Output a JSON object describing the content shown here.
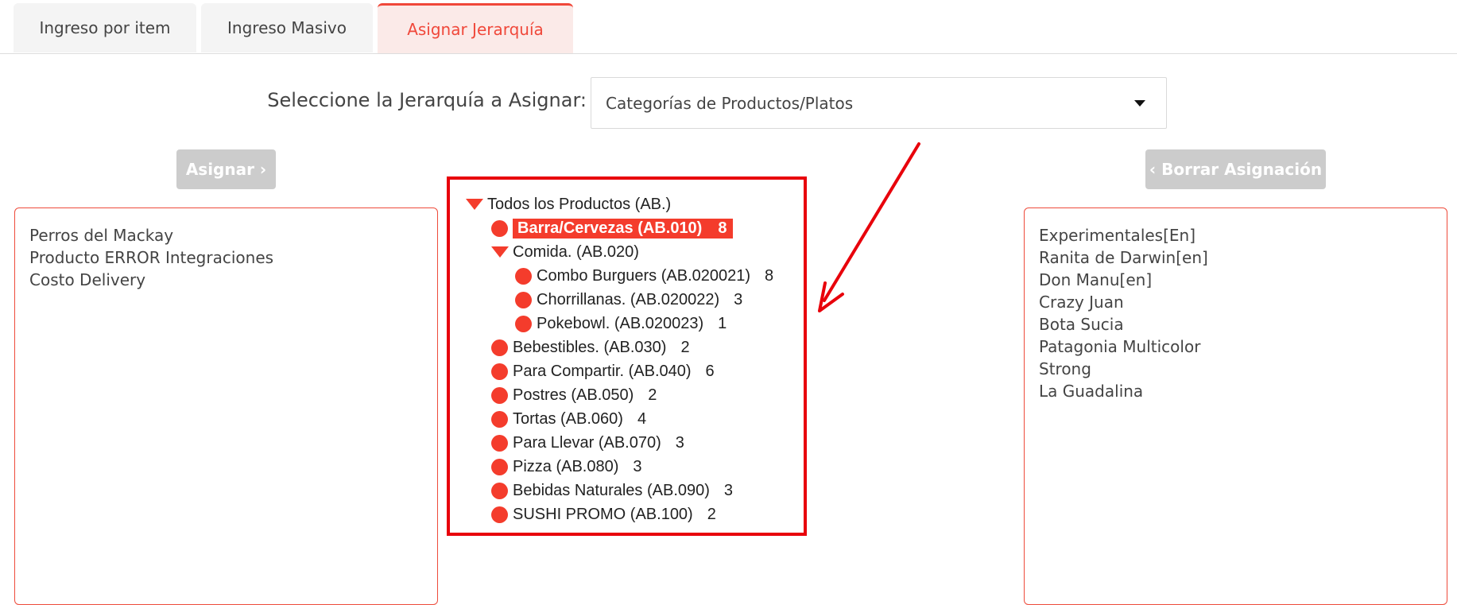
{
  "tabs": [
    {
      "label": "Ingreso por item",
      "active": false
    },
    {
      "label": "Ingreso Masivo",
      "active": false
    },
    {
      "label": "Asignar Jerarquía",
      "active": true
    }
  ],
  "selector": {
    "label": "Seleccione la Jerarquía a Asignar:",
    "value": "Categorías de Productos/Platos"
  },
  "buttons": {
    "assign": "Asignar ›",
    "clear": "‹ Borrar Asignación"
  },
  "left_list": [
    "Perros del Mackay",
    "Producto ERROR Integraciones",
    "Costo Delivery"
  ],
  "tree": {
    "root": "Todos los Productos (AB.)",
    "selected": {
      "label": "Barra/Cervezas (AB.010)",
      "count": "8"
    },
    "comida": "Comida. (AB.020)",
    "comida_children": [
      {
        "label": "Combo Burguers (AB.020021)",
        "count": "8"
      },
      {
        "label": "Chorrillanas. (AB.020022)",
        "count": "3"
      },
      {
        "label": "Pokebowl. (AB.020023)",
        "count": "1"
      }
    ],
    "items": [
      {
        "label": "Bebestibles. (AB.030)",
        "count": "2"
      },
      {
        "label": "Para Compartir. (AB.040)",
        "count": "6"
      },
      {
        "label": "Postres (AB.050)",
        "count": "2"
      },
      {
        "label": "Tortas (AB.060)",
        "count": "4"
      },
      {
        "label": "Para Llevar (AB.070)",
        "count": "3"
      },
      {
        "label": "Pizza (AB.080)",
        "count": "3"
      },
      {
        "label": "Bebidas Naturales (AB.090)",
        "count": "3"
      },
      {
        "label": "SUSHI PROMO (AB.100)",
        "count": "2"
      }
    ]
  },
  "right_list": [
    "Experimentales[En]",
    "Ranita de Darwin[en]",
    "Don Manu[en]",
    "Crazy Juan",
    "Bota Sucia",
    "Patagonia Multicolor",
    "Strong",
    "La Guadalina"
  ],
  "colors": {
    "accent": "#f43c2c",
    "annotation": "#e8000b",
    "button_disabled": "#cccccc"
  }
}
